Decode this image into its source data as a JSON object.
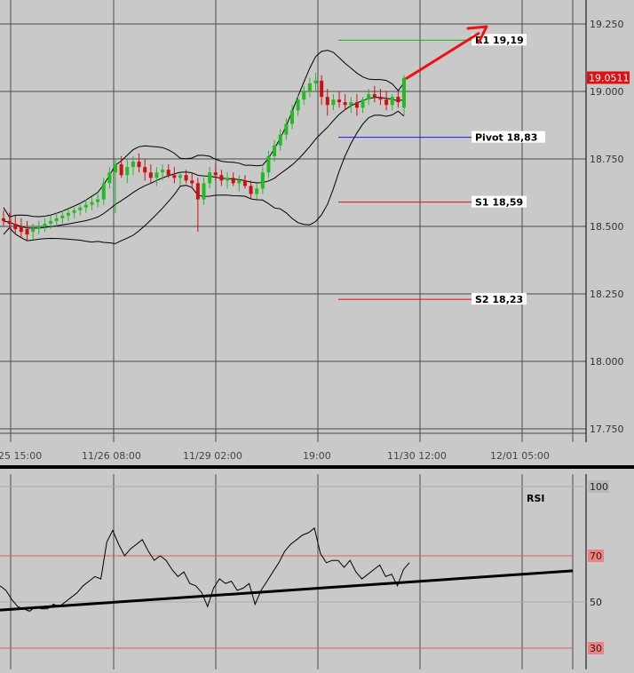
{
  "colors": {
    "background": "#c9c9c9",
    "grid": "#4a4a4a",
    "candle_up": "#22bb22",
    "candle_down": "#cc1010",
    "bollinger": "#000000",
    "r1_line": "#22aa22",
    "pivot_line": "#1a1aee",
    "support_line": "#dd1111",
    "arrow": "#ee1111",
    "current_price_bg": "#dd1111",
    "rsi_level_box": "#f08080",
    "rsi_line": "#000000",
    "trendline": "#000000"
  },
  "chart_data": [
    {
      "type": "candlestick",
      "ylim": [
        17.7,
        19.3
      ],
      "y_ticks": [
        "19.250",
        "19.000",
        "18.750",
        "18.500",
        "18.250",
        "18.000",
        "17.750"
      ],
      "y_tick_values": [
        19.25,
        19.0,
        18.75,
        18.5,
        18.25,
        18.0,
        17.75
      ],
      "x_ticks": [
        "25 15:00",
        "11/26 08:00",
        "11/29 02:00",
        "19:00",
        "11/30 12:00",
        "12/01 05:00"
      ],
      "current_price": "19.0511",
      "current_price_value": 19.0511,
      "levels": [
        {
          "label": "R1 19,19",
          "value": 19.19,
          "kind": "resistance"
        },
        {
          "label": "Pivot 18,83",
          "value": 18.83,
          "kind": "pivot"
        },
        {
          "label": "S1 18,59",
          "value": 18.59,
          "kind": "support"
        },
        {
          "label": "S2 18,23",
          "value": 18.23,
          "kind": "support"
        }
      ],
      "candles": [
        [
          18.53,
          18.56,
          18.5,
          18.52
        ],
        [
          18.52,
          18.55,
          18.49,
          18.51
        ],
        [
          18.51,
          18.54,
          18.47,
          18.49
        ],
        [
          18.5,
          18.53,
          18.46,
          18.48
        ],
        [
          18.49,
          18.52,
          18.45,
          18.47
        ],
        [
          18.48,
          18.51,
          18.45,
          18.49
        ],
        [
          18.49,
          18.52,
          18.47,
          18.5
        ],
        [
          18.5,
          18.53,
          18.48,
          18.51
        ],
        [
          18.51,
          18.54,
          18.49,
          18.52
        ],
        [
          18.52,
          18.55,
          18.5,
          18.53
        ],
        [
          18.53,
          18.56,
          18.51,
          18.54
        ],
        [
          18.54,
          18.57,
          18.52,
          18.55
        ],
        [
          18.55,
          18.57,
          18.53,
          18.56
        ],
        [
          18.56,
          18.58,
          18.54,
          18.57
        ],
        [
          18.57,
          18.6,
          18.55,
          18.58
        ],
        [
          18.58,
          18.61,
          18.56,
          18.59
        ],
        [
          18.59,
          18.62,
          18.57,
          18.6
        ],
        [
          18.6,
          18.68,
          18.58,
          18.66
        ],
        [
          18.66,
          18.72,
          18.64,
          18.7
        ],
        [
          18.7,
          18.75,
          18.55,
          18.73
        ],
        [
          18.73,
          18.76,
          18.68,
          18.69
        ],
        [
          18.69,
          18.75,
          18.66,
          18.72
        ],
        [
          18.72,
          18.76,
          18.69,
          18.74
        ],
        [
          18.74,
          18.77,
          18.7,
          18.72
        ],
        [
          18.72,
          18.75,
          18.67,
          18.7
        ],
        [
          18.7,
          18.73,
          18.66,
          18.68
        ],
        [
          18.68,
          18.72,
          18.65,
          18.7
        ],
        [
          18.7,
          18.73,
          18.67,
          18.71
        ],
        [
          18.71,
          18.73,
          18.68,
          18.69
        ],
        [
          18.69,
          18.72,
          18.66,
          18.68
        ],
        [
          18.68,
          18.7,
          18.65,
          18.69
        ],
        [
          18.69,
          18.71,
          18.66,
          18.67
        ],
        [
          18.67,
          18.7,
          18.64,
          18.66
        ],
        [
          18.66,
          18.68,
          18.48,
          18.6
        ],
        [
          18.6,
          18.68,
          18.58,
          18.66
        ],
        [
          18.66,
          18.72,
          18.64,
          18.7
        ],
        [
          18.7,
          18.73,
          18.67,
          18.69
        ],
        [
          18.69,
          18.71,
          18.65,
          18.67
        ],
        [
          18.67,
          18.7,
          18.64,
          18.68
        ],
        [
          18.68,
          18.7,
          18.65,
          18.66
        ],
        [
          18.66,
          18.69,
          18.63,
          18.67
        ],
        [
          18.67,
          18.69,
          18.64,
          18.65
        ],
        [
          18.65,
          18.67,
          18.6,
          18.62
        ],
        [
          18.62,
          18.66,
          18.6,
          18.64
        ],
        [
          18.64,
          18.72,
          18.62,
          18.7
        ],
        [
          18.7,
          18.78,
          18.68,
          18.76
        ],
        [
          18.76,
          18.82,
          18.74,
          18.8
        ],
        [
          18.8,
          18.86,
          18.78,
          18.84
        ],
        [
          18.84,
          18.9,
          18.82,
          18.88
        ],
        [
          18.88,
          18.95,
          18.86,
          18.93
        ],
        [
          18.93,
          18.99,
          18.91,
          18.97
        ],
        [
          18.97,
          19.02,
          18.95,
          19.0
        ],
        [
          19.0,
          19.05,
          18.98,
          19.03
        ],
        [
          19.03,
          19.07,
          19.0,
          19.04
        ],
        [
          19.04,
          19.06,
          18.95,
          18.98
        ],
        [
          18.98,
          19.01,
          18.91,
          18.95
        ],
        [
          18.95,
          18.99,
          18.93,
          18.97
        ],
        [
          18.97,
          19.0,
          18.94,
          18.96
        ],
        [
          18.96,
          18.99,
          18.93,
          18.95
        ],
        [
          18.95,
          18.98,
          18.92,
          18.96
        ],
        [
          18.96,
          18.99,
          18.91,
          18.94
        ],
        [
          18.94,
          18.98,
          18.92,
          18.97
        ],
        [
          18.97,
          19.01,
          18.95,
          18.99
        ],
        [
          18.99,
          19.02,
          18.96,
          18.98
        ],
        [
          18.98,
          19.01,
          18.95,
          18.97
        ],
        [
          18.97,
          19.0,
          18.93,
          18.95
        ],
        [
          18.95,
          18.99,
          18.93,
          18.98
        ],
        [
          18.98,
          19.0,
          18.94,
          18.96
        ],
        [
          18.94,
          19.06,
          18.91,
          19.05
        ]
      ]
    },
    {
      "type": "line",
      "title": "RSI",
      "ylim": [
        25,
        100
      ],
      "y_ticks": [
        "100",
        "70",
        "50",
        "30"
      ],
      "y_tick_values": [
        100,
        70,
        50,
        30
      ],
      "level_lines": [
        70,
        30
      ],
      "values": [
        57,
        55,
        51,
        48,
        47,
        46,
        48,
        47,
        47,
        49,
        48,
        50,
        52,
        54,
        57,
        59,
        61,
        60,
        76,
        81,
        75,
        70,
        73,
        75,
        77,
        72,
        68,
        70,
        68,
        64,
        61,
        63,
        58,
        57,
        54,
        48,
        56,
        60,
        58,
        59,
        55,
        56,
        58,
        49,
        55,
        59,
        63,
        67,
        72,
        75,
        77,
        79,
        80,
        82,
        71,
        67,
        68,
        68,
        65,
        68,
        63,
        60,
        62,
        64,
        66,
        61,
        62,
        57,
        64,
        67
      ],
      "trendline": [
        [
          0,
          46.5
        ],
        [
          1,
          63.5
        ]
      ]
    }
  ]
}
